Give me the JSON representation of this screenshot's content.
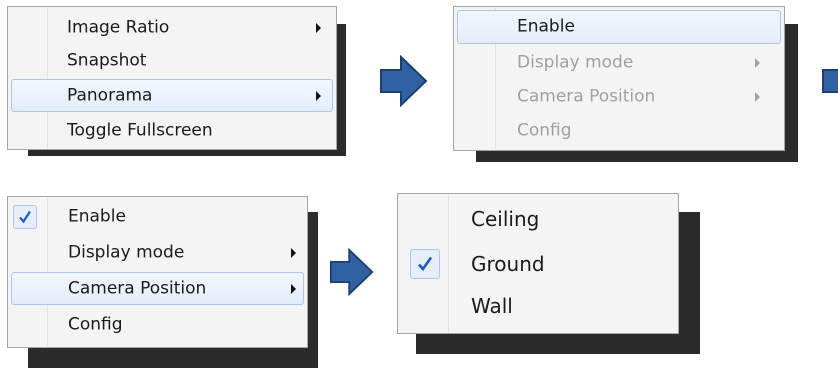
{
  "menu1": {
    "items": [
      {
        "label": "Image Ratio",
        "submenu": true
      },
      {
        "label": "Snapshot",
        "submenu": false
      },
      {
        "label": "Panorama",
        "submenu": true,
        "highlighted": true
      },
      {
        "label": "Toggle Fullscreen",
        "submenu": false
      }
    ]
  },
  "menu2": {
    "items": [
      {
        "label": "Enable",
        "highlighted": true
      },
      {
        "label": "Display mode",
        "submenu": true,
        "disabled": true
      },
      {
        "label": "Camera Position",
        "submenu": true,
        "disabled": true
      },
      {
        "label": "Config",
        "disabled": true
      }
    ]
  },
  "menu3": {
    "items": [
      {
        "label": "Enable",
        "checked": true
      },
      {
        "label": "Display mode",
        "submenu": true
      },
      {
        "label": "Camera Position",
        "submenu": true,
        "highlighted": true
      },
      {
        "label": "Config"
      }
    ]
  },
  "menu4": {
    "items": [
      {
        "label": "Ceiling"
      },
      {
        "label": "Ground",
        "checked": true
      },
      {
        "label": "Wall"
      }
    ]
  },
  "icons": {
    "flow_arrow": "right-arrow-icon",
    "submenu_arrow": "chevron-right-icon",
    "check": "checkmark-icon"
  },
  "colors": {
    "flow_arrow_fill": "#2f61a3",
    "flow_arrow_stroke": "#1e3f6e",
    "highlight_border": "#a9c6ec",
    "check_color": "#1e5bc6"
  }
}
